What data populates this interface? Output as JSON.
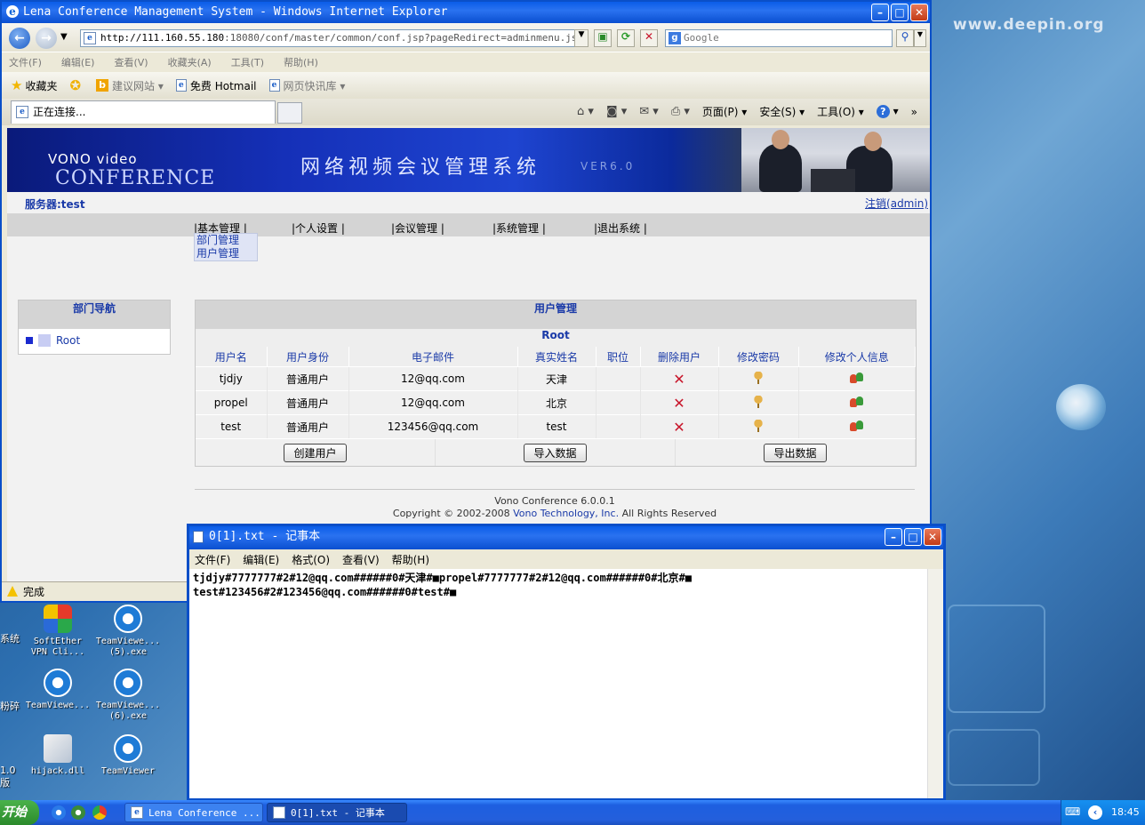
{
  "desktop": {
    "watermark": "www.deepin.org",
    "icons": [
      {
        "label1": "SoftEther",
        "label2": "VPN Cli..."
      },
      {
        "label1": "TeamViewe...",
        "label2": "(5).exe"
      },
      {
        "label1": "TeamViewe...",
        "label2": ""
      },
      {
        "label1": "TeamViewe...",
        "label2": "(6).exe"
      },
      {
        "label1": "hijack.dll",
        "label2": ""
      },
      {
        "label1": "TeamViewer",
        "label2": ""
      }
    ],
    "edge_labels": [
      "系统",
      "粉碎",
      "1.0",
      "版"
    ]
  },
  "ie": {
    "title": "Lena Conference Management System - Windows Internet Explorer",
    "address_host": "http://111.160.55.180",
    "address_path": ":18080/conf/master/common/conf.jsp?pageRedirect=adminmenu.jsp",
    "search_placeholder": "Google",
    "menus": [
      "文件(F)",
      "编辑(E)",
      "查看(V)",
      "收藏夹(A)",
      "工具(T)",
      "帮助(H)"
    ],
    "favorites": {
      "label": "收藏夹",
      "suggested": "建议网站 ▾",
      "hotmail": "免费 Hotmail",
      "webslice": "网页快讯库 ▾"
    },
    "tab_label": "正在连接...",
    "commands": {
      "page": "页面(P) ▾",
      "safety": "安全(S) ▾",
      "tools": "工具(O) ▾"
    },
    "status": "完成"
  },
  "page": {
    "banner": {
      "brand_top": "VONO video",
      "brand_bottom": "CONFERENCE",
      "title_cn": "网络视频会议管理系统",
      "version": "VER6.0"
    },
    "server_label": "服务器:test",
    "logout": "注销(admin)",
    "nav": [
      "|基本管理 |",
      "|个人设置 |",
      "|会议管理 |",
      "|系统管理 |",
      "|退出系统 |"
    ],
    "submenu": [
      "部门管理",
      "用户管理"
    ],
    "dept_nav": {
      "title": "部门导航",
      "root": "Root"
    },
    "users": {
      "title": "用户管理",
      "group": "Root",
      "columns": [
        "用户名",
        "用户身份",
        "电子邮件",
        "真实姓名",
        "职位",
        "删除用户",
        "修改密码",
        "修改个人信息"
      ],
      "rows": [
        {
          "username": "tjdjy",
          "role": "普通用户",
          "email": "12@qq.com",
          "realname": "天津",
          "position": ""
        },
        {
          "username": "propel",
          "role": "普通用户",
          "email": "12@qq.com",
          "realname": "北京",
          "position": ""
        },
        {
          "username": "test",
          "role": "普通用户",
          "email": "123456@qq.com",
          "realname": "test",
          "position": ""
        }
      ],
      "buttons": {
        "create": "创建用户",
        "import": "导入数据",
        "export": "导出数据"
      }
    },
    "footer": {
      "line1": "Vono Conference 6.0.0.1",
      "copy_prefix": "Copyright © 2002-2008 ",
      "company": "Vono Technology, Inc.",
      "copy_suffix": " All Rights Reserved"
    }
  },
  "notepad": {
    "title": "0[1].txt - 记事本",
    "menus": [
      "文件(F)",
      "编辑(E)",
      "格式(O)",
      "查看(V)",
      "帮助(H)"
    ],
    "line1": "tjdjy#7777777#2#12@qq.com######0#天津#■propel#7777777#2#12@qq.com######0#北京#■",
    "line2": "test#123456#2#123456@qq.com######0#test#■"
  },
  "taskbar": {
    "start": "开始",
    "tasks": [
      "Lena Conference ...",
      "0[1].txt - 记事本"
    ],
    "clock": "18:45"
  },
  "colors": {
    "titlebar": "#0a5de8",
    "link": "#1a3aa8",
    "delete": "#c8162b",
    "taskbar": "#245fdc"
  }
}
